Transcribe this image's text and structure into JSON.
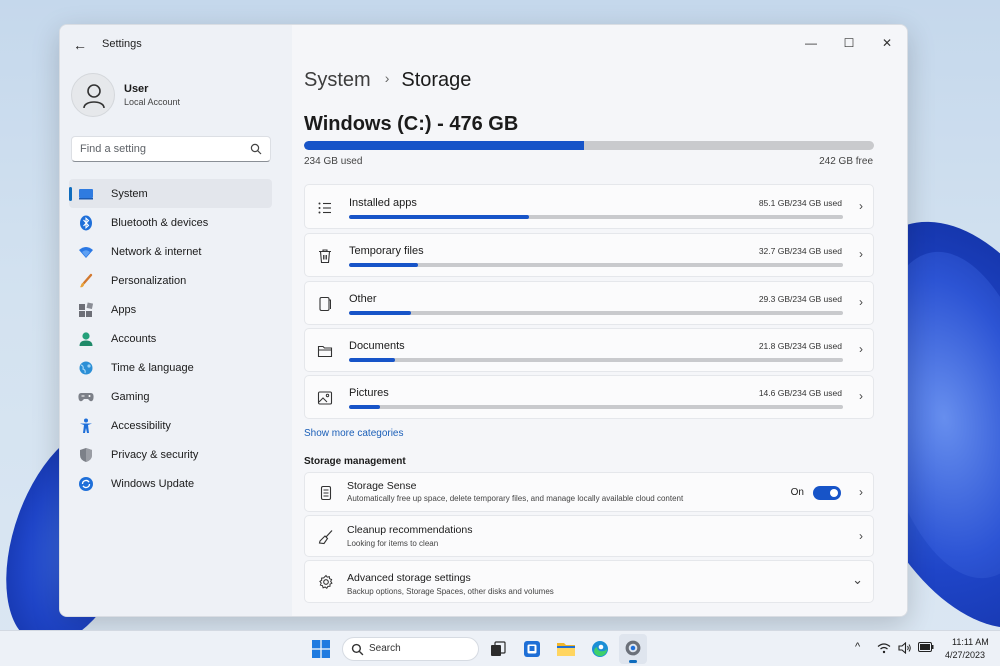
{
  "window": {
    "app_title": "Settings",
    "back_glyph": "←",
    "controls": {
      "minimize": "—",
      "maximize": "☐",
      "close": "✕"
    }
  },
  "user": {
    "name": "User",
    "account_type": "Local Account"
  },
  "search": {
    "placeholder": "Find a setting"
  },
  "nav": {
    "items": [
      {
        "label": "System",
        "icon": "system-icon",
        "active": true
      },
      {
        "label": "Bluetooth & devices",
        "icon": "bluetooth-icon"
      },
      {
        "label": "Network & internet",
        "icon": "wifi-icon"
      },
      {
        "label": "Personalization",
        "icon": "brush-icon"
      },
      {
        "label": "Apps",
        "icon": "apps-icon"
      },
      {
        "label": "Accounts",
        "icon": "accounts-icon"
      },
      {
        "label": "Time & language",
        "icon": "globe-icon"
      },
      {
        "label": "Gaming",
        "icon": "controller-icon"
      },
      {
        "label": "Accessibility",
        "icon": "accessibility-icon"
      },
      {
        "label": "Privacy & security",
        "icon": "shield-icon"
      },
      {
        "label": "Windows Update",
        "icon": "update-icon"
      }
    ]
  },
  "breadcrumb": {
    "parent": "System",
    "separator": "›",
    "current": "Storage"
  },
  "drive": {
    "title": "Windows (C:) - 476 GB",
    "used_label": "234 GB used",
    "free_label": "242 GB free",
    "used_fraction": 0.4916
  },
  "categories": [
    {
      "name": "Installed apps",
      "size": "85.1 GB/234 GB used",
      "fraction": 0.3637,
      "icon": "list-icon"
    },
    {
      "name": "Temporary files",
      "size": "32.7 GB/234 GB used",
      "fraction": 0.1397,
      "icon": "trash-icon"
    },
    {
      "name": "Other",
      "size": "29.3 GB/234 GB used",
      "fraction": 0.1252,
      "icon": "file-icon"
    },
    {
      "name": "Documents",
      "size": "21.8 GB/234 GB used",
      "fraction": 0.0932,
      "icon": "folder-icon"
    },
    {
      "name": "Pictures",
      "size": "14.6 GB/234 GB used",
      "fraction": 0.0624,
      "icon": "image-icon"
    }
  ],
  "show_more": "Show more categories",
  "storage_management": {
    "title": "Storage management",
    "storage_sense": {
      "title": "Storage Sense",
      "subtitle": "Automatically free up space, delete temporary files, and manage locally available cloud content",
      "state": "On"
    },
    "cleanup": {
      "title": "Cleanup recommendations",
      "subtitle": "Looking for items to clean"
    },
    "advanced": {
      "title": "Advanced storage settings",
      "subtitle": "Backup options, Storage Spaces, other disks and volumes"
    }
  },
  "chevron": "›",
  "chevron_down": "⌄",
  "taskbar": {
    "search_label": "Search",
    "time": "11:11 AM",
    "date": "4/27/2023",
    "tray_up": "^"
  },
  "colors": {
    "accent": "#1754c8",
    "windows_blue": "#0f6cbd"
  }
}
